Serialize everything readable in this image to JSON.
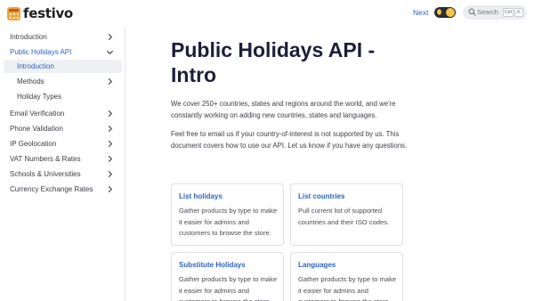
{
  "brand": {
    "name": "festivo"
  },
  "header": {
    "next_label": "Next",
    "search_placeholder": "Search",
    "search_key_1": "Ctrl",
    "search_key_2": "K"
  },
  "sidebar": {
    "items": [
      {
        "label": "Introduction",
        "chevron": "chevron-right-icon"
      },
      {
        "label": "Public Holidays API",
        "chevron": "chevron-down-icon"
      },
      {
        "label": "Introduction"
      },
      {
        "label": "Methods",
        "chevron": "chevron-right-icon"
      },
      {
        "label": "Holiday Types"
      },
      {
        "label": "Email Verification",
        "chevron": "chevron-right-icon"
      },
      {
        "label": "Phone Validation",
        "chevron": "chevron-right-icon"
      },
      {
        "label": "IP Geolocation",
        "chevron": "chevron-right-icon"
      },
      {
        "label": "VAT Numbers & Rates",
        "chevron": "chevron-right-icon"
      },
      {
        "label": "Schools & Universities",
        "chevron": "chevron-right-icon"
      },
      {
        "label": "Currency Exchange Rates",
        "chevron": "chevron-right-icon"
      }
    ]
  },
  "main": {
    "title": "Public Holidays API - Intro",
    "paragraph_1": "We cover 250+ countries, states and regions around the world, and we're constantly working on adding new countries, states and languages.",
    "paragraph_2": "Feel free to email us if your country-of-interest is not supported by us. This document covers how to use our API. Let us know if you have any questions.",
    "cards": [
      {
        "title": "List holidays",
        "description": "Gather products by type to make it easier for admins and customers to browse the store."
      },
      {
        "title": "List countries",
        "description": "Pull current list of supported countries and their ISO codes."
      },
      {
        "title": "Substitute Holidays",
        "description": "Gather products by type to make it easier for admins and customers to browse the store."
      },
      {
        "title": "Languages",
        "description": "Gather products by type to make it easier for admins and customers to browse the store."
      }
    ]
  },
  "colors": {
    "accent": "#2e63c4",
    "title": "#1c1e3a",
    "active_bg": "#eef0f3",
    "logo": "#f2a33a"
  }
}
